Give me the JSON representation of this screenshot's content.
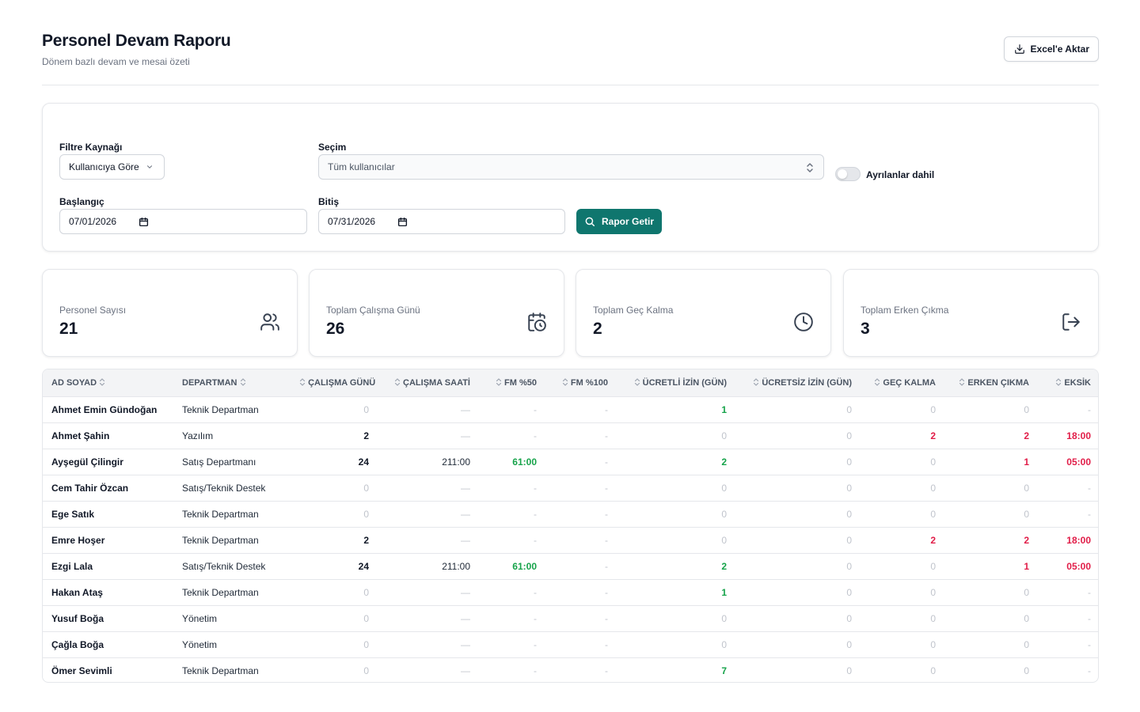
{
  "header": {
    "title": "Personel Devam Raporu",
    "subtitle": "Dönem bazlı devam ve mesai özeti",
    "export_label": "Excel'e Aktar"
  },
  "filters": {
    "source_label": "Filtre Kaynağı",
    "source_value": "Kullanıcıya Göre",
    "selection_label": "Seçim",
    "selection_value": "Tüm kullanıcılar",
    "include_left_label": "Ayrılanlar dahil",
    "include_left_on": false,
    "start_label": "Başlangıç",
    "start_value": "07/01/2026",
    "end_label": "Bitiş",
    "end_value": "07/31/2026",
    "run_label": "Rapor Getir"
  },
  "stats": [
    {
      "label": "Personel Sayısı",
      "value": "21",
      "icon": "users-icon"
    },
    {
      "label": "Toplam Çalışma Günü",
      "value": "26",
      "icon": "calendar-clock-icon"
    },
    {
      "label": "Toplam Geç Kalma",
      "value": "2",
      "icon": "clock-icon"
    },
    {
      "label": "Toplam Erken Çıkma",
      "value": "3",
      "icon": "logout-icon"
    }
  ],
  "table": {
    "columns": [
      "AD SOYAD",
      "DEPARTMAN",
      "ÇALIŞMA GÜNÜ",
      "ÇALIŞMA SAATİ",
      "FM %50",
      "FM %100",
      "ÜCRETLİ İZİN (GÜN)",
      "ÜCRETSİZ İZİN (GÜN)",
      "GEÇ KALMA",
      "ERKEN ÇIKMA",
      "EKSİK"
    ],
    "rows": [
      [
        "Ahmet Emin Gündoğan",
        "Teknik Departman",
        "0",
        "—",
        "-",
        "-",
        "1",
        "0",
        "0",
        "0",
        "-"
      ],
      [
        "Ahmet Şahin",
        "Yazılım",
        "2",
        "—",
        "-",
        "-",
        "0",
        "0",
        "2",
        "2",
        "18:00"
      ],
      [
        "Ayşegül Çilingir",
        "Satış Departmanı",
        "24",
        "211:00",
        "61:00",
        "-",
        "2",
        "0",
        "0",
        "1",
        "05:00"
      ],
      [
        "Cem Tahir Özcan",
        "Satış/Teknik Destek",
        "0",
        "—",
        "-",
        "-",
        "0",
        "0",
        "0",
        "0",
        "-"
      ],
      [
        "Ege Satık",
        "Teknik Departman",
        "0",
        "—",
        "-",
        "-",
        "0",
        "0",
        "0",
        "0",
        "-"
      ],
      [
        "Emre Hoşer",
        "Teknik Departman",
        "2",
        "—",
        "-",
        "-",
        "0",
        "0",
        "2",
        "2",
        "18:00"
      ],
      [
        "Ezgi Lala",
        "Satış/Teknik Destek",
        "24",
        "211:00",
        "61:00",
        "-",
        "2",
        "0",
        "0",
        "1",
        "05:00"
      ],
      [
        "Hakan Ataş",
        "Teknik Departman",
        "0",
        "—",
        "-",
        "-",
        "1",
        "0",
        "0",
        "0",
        "-"
      ],
      [
        "Yusuf Boğa",
        "Yönetim",
        "0",
        "—",
        "-",
        "-",
        "0",
        "0",
        "0",
        "0",
        "-"
      ],
      [
        "Çağla Boğa",
        "Yönetim",
        "0",
        "—",
        "-",
        "-",
        "0",
        "0",
        "0",
        "0",
        "-"
      ],
      [
        "Ömer Sevimli",
        "Teknik Departman",
        "0",
        "—",
        "-",
        "-",
        "7",
        "0",
        "0",
        "0",
        "-"
      ]
    ],
    "styles": [
      [
        "name",
        "dept",
        "muted",
        "muted",
        "muted",
        "muted",
        "green",
        "muted",
        "muted",
        "muted",
        "muted"
      ],
      [
        "name",
        "dept",
        "strong",
        "muted",
        "muted",
        "muted",
        "muted",
        "muted",
        "red",
        "red",
        "red"
      ],
      [
        "name",
        "dept",
        "strong",
        "plain",
        "green",
        "muted",
        "green",
        "muted",
        "muted",
        "red",
        "red"
      ],
      [
        "name",
        "dept",
        "muted",
        "muted",
        "muted",
        "muted",
        "muted",
        "muted",
        "muted",
        "muted",
        "muted"
      ],
      [
        "name",
        "dept",
        "muted",
        "muted",
        "muted",
        "muted",
        "muted",
        "muted",
        "muted",
        "muted",
        "muted"
      ],
      [
        "name",
        "dept",
        "strong",
        "muted",
        "muted",
        "muted",
        "muted",
        "muted",
        "red",
        "red",
        "red"
      ],
      [
        "name",
        "dept",
        "strong",
        "plain",
        "green",
        "muted",
        "green",
        "muted",
        "muted",
        "red",
        "red"
      ],
      [
        "name",
        "dept",
        "muted",
        "muted",
        "muted",
        "muted",
        "green",
        "muted",
        "muted",
        "muted",
        "muted"
      ],
      [
        "name",
        "dept",
        "muted",
        "muted",
        "muted",
        "muted",
        "muted",
        "muted",
        "muted",
        "muted",
        "muted"
      ],
      [
        "name",
        "dept",
        "muted",
        "muted",
        "muted",
        "muted",
        "muted",
        "muted",
        "muted",
        "muted",
        "muted"
      ],
      [
        "name",
        "dept",
        "muted",
        "muted",
        "muted",
        "muted",
        "green",
        "muted",
        "muted",
        "muted",
        "muted"
      ]
    ]
  },
  "colors": {
    "accent": "#0f766e",
    "positive": "#16a34a",
    "negative": "#e11d48",
    "muted": "#c0c4cc"
  }
}
